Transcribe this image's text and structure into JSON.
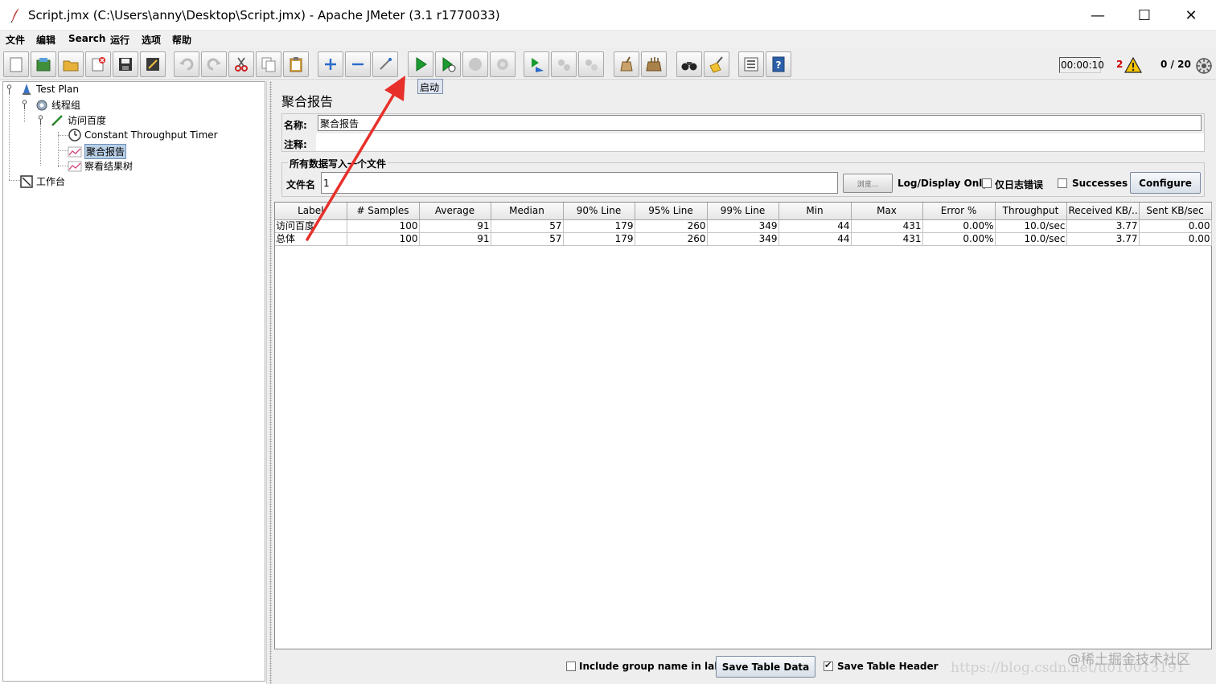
{
  "window": {
    "title": "Script.jmx (C:\\Users\\anny\\Desktop\\Script.jmx) - Apache JMeter (3.1 r1770033)",
    "minimize": "—",
    "maximize": "☐",
    "close": "✕"
  },
  "menu": {
    "items": [
      "文件",
      "编辑",
      "Search",
      "运行",
      "选项",
      "帮助"
    ]
  },
  "toolbar": {
    "timer": "00:00:10",
    "error_count": "2",
    "threads": "0 / 20",
    "tooltip": "启动",
    "colors": {
      "start_green": "#1a9b2f",
      "error_red": "#d00000",
      "warning_yellow": "#f5c400"
    }
  },
  "tree": {
    "nodes": [
      "Test Plan",
      "线程组",
      "访问百度",
      "Constant Throughput Timer",
      "聚合报告",
      "察看结果树",
      "工作台"
    ],
    "selected": "聚合报告"
  },
  "panel": {
    "title": "聚合报告",
    "name_label": "名称:",
    "name_value": "聚合报告",
    "comment_label": "注释:",
    "file_group_title": "所有数据写入一个文件",
    "filename_label": "文件名",
    "filename_value": "1",
    "browse_label": "浏览...",
    "log_display_label": "Log/Display Only:",
    "errors_only_label": "仅日志错误",
    "successes_label": "Successes",
    "configure_label": "Configure"
  },
  "table": {
    "headers": [
      "Label",
      "# Samples",
      "Average",
      "Median",
      "90% Line",
      "95% Line",
      "99% Line",
      "Min",
      "Max",
      "Error %",
      "Throughput",
      "Received KB/...",
      "Sent KB/sec"
    ],
    "rows": [
      [
        "访问百度",
        "100",
        "91",
        "57",
        "179",
        "260",
        "349",
        "44",
        "431",
        "0.00%",
        "10.0/sec",
        "3.77",
        "0.00"
      ],
      [
        "总体",
        "100",
        "91",
        "57",
        "179",
        "260",
        "349",
        "44",
        "431",
        "0.00%",
        "10.0/sec",
        "3.77",
        "0.00"
      ]
    ]
  },
  "bottom": {
    "include_group_label": "Include group name in label?",
    "save_data_label": "Save Table Data",
    "save_header_label": "Save Table Header",
    "save_header_checked": true
  },
  "watermark": {
    "community": "@稀土掘金技术社区",
    "url": "https://blog.csdn.net/u010013191"
  },
  "annotation": {
    "arrow_color": "#e8302a"
  }
}
